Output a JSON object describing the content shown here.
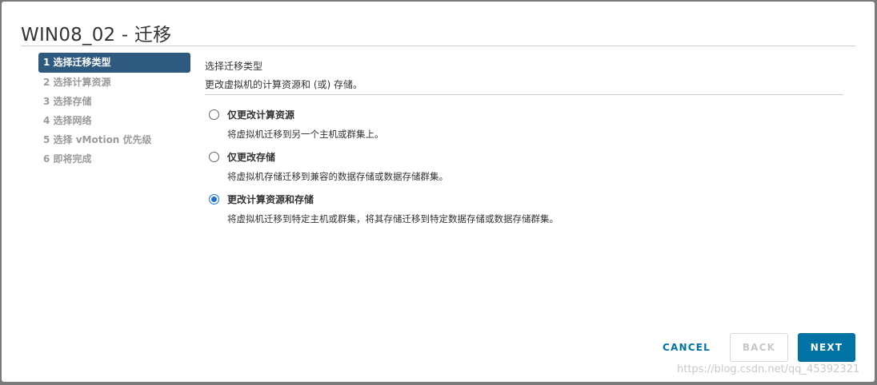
{
  "dialog": {
    "title": "WIN08_02 - 迁移"
  },
  "steps": [
    {
      "label": "1 选择迁移类型",
      "active": true
    },
    {
      "label": "2 选择计算资源",
      "active": false
    },
    {
      "label": "3 选择存储",
      "active": false
    },
    {
      "label": "4 选择网络",
      "active": false
    },
    {
      "label": "5 选择 vMotion 优先级",
      "active": false
    },
    {
      "label": "6 即将完成",
      "active": false
    }
  ],
  "content": {
    "heading": "选择迁移类型",
    "subheading": "更改虚拟机的计算资源和 (或) 存储。"
  },
  "options": [
    {
      "label": "仅更改计算资源",
      "description": "将虚拟机迁移到另一个主机或群集上。",
      "selected": false
    },
    {
      "label": "仅更改存储",
      "description": "将虚拟机存储迁移到兼容的数据存储或数据存储群集。",
      "selected": false
    },
    {
      "label": "更改计算资源和存储",
      "description": "将虚拟机迁移到特定主机或群集，将其存储迁移到特定数据存储或数据存储群集。",
      "selected": true
    }
  ],
  "buttons": {
    "cancel": "CANCEL",
    "back": "BACK",
    "next": "NEXT"
  },
  "watermark": "https://blog.csdn.net/qq_45392321",
  "colors": {
    "active_step_bg": "#2f5a7f",
    "primary": "#0072a3",
    "radio_selected": "#1e73d2",
    "disabled_text": "#c8c8c8"
  }
}
